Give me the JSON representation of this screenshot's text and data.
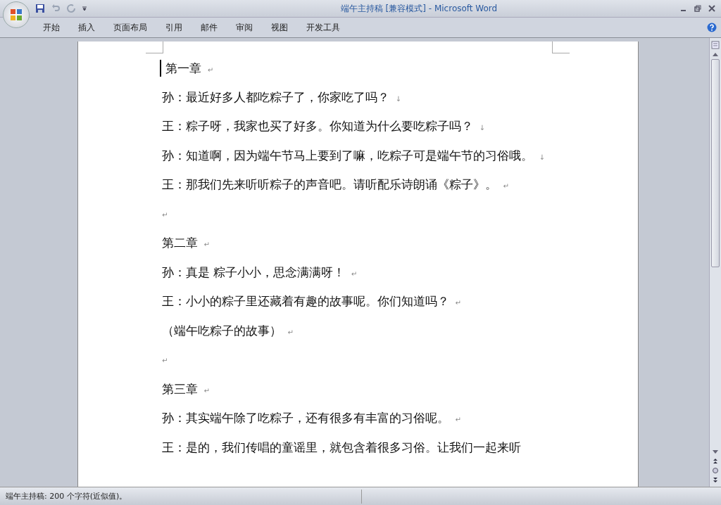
{
  "window": {
    "title": "端午主持稿 [兼容模式] - Microsoft Word"
  },
  "tabs": [
    {
      "label": "开始",
      "selected": false
    },
    {
      "label": "插入",
      "selected": false
    },
    {
      "label": "页面布局",
      "selected": false
    },
    {
      "label": "引用",
      "selected": false
    },
    {
      "label": "邮件",
      "selected": false
    },
    {
      "label": "审阅",
      "selected": false
    },
    {
      "label": "视图",
      "selected": false
    },
    {
      "label": "开发工具",
      "selected": false
    }
  ],
  "document": {
    "paragraphs": [
      {
        "text": "第一章",
        "mark": "↵"
      },
      {
        "text": "孙：最近好多人都吃粽子了，你家吃了吗？",
        "mark": "↓"
      },
      {
        "text": "王：粽子呀，我家也买了好多。你知道为什么要吃粽子吗？",
        "mark": "↓"
      },
      {
        "text": "孙：知道啊，因为端午节马上要到了嘛，吃粽子可是端午节的习俗哦。",
        "mark": "↓"
      },
      {
        "text": "王：那我们先来听听粽子的声音吧。请听配乐诗朗诵《粽子》。",
        "mark": "↵"
      },
      {
        "mark": "↵"
      },
      {
        "text": "第二章",
        "mark": "↵"
      },
      {
        "text": "孙：真是 粽子小小，思念满满呀！",
        "mark": "↵"
      },
      {
        "text": "王：小小的粽子里还藏着有趣的故事呢。你们知道吗？",
        "mark": "↵"
      },
      {
        "text": "（端午吃粽子的故事）",
        "mark": "↵"
      },
      {
        "mark": "↵"
      },
      {
        "text": "第三章",
        "mark": "↵"
      },
      {
        "text": "孙：其实端午除了吃粽子，还有很多有丰富的习俗呢。",
        "mark": "↵"
      },
      {
        "text": "王：是的，我们传唱的童谣里，就包含着很多习俗。让我们一起来听"
      }
    ]
  },
  "status_bar": {
    "text": "端午主持稿: 200 个字符(近似值)。"
  }
}
